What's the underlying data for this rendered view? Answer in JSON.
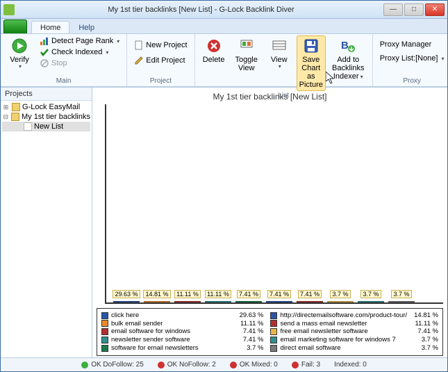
{
  "window": {
    "title": "My 1st tier backlinks [New List] - G-Lock Backlink Diver"
  },
  "tabs": {
    "home": "Home",
    "help": "Help"
  },
  "ribbon": {
    "main": {
      "label": "Main",
      "verify": "Verify",
      "detect_page_rank": "Detect Page Rank",
      "check_indexed": "Check Indexed",
      "stop": "Stop"
    },
    "project": {
      "label": "Project",
      "new_project": "New Project",
      "edit_project": "Edit Project"
    },
    "list": {
      "label": "List",
      "delete": "Delete",
      "toggle_view": "Toggle View",
      "view": "View",
      "save_chart_l1": "Save Chart",
      "save_chart_l2": "as Picture",
      "add_backlinks_l1": "Add to Backlinks",
      "add_backlinks_l2": "Indexer"
    },
    "proxy": {
      "label": "Proxy",
      "proxy_manager": "Proxy Manager",
      "proxy_list": "Proxy List:[None]"
    }
  },
  "sidebar": {
    "title": "Projects",
    "items": [
      {
        "label": "G-Lock EasyMail",
        "expanded": false
      },
      {
        "label": "My 1st tier backlinks",
        "expanded": true,
        "children": [
          {
            "label": "New List",
            "selected": true
          }
        ]
      }
    ]
  },
  "chart_title": "My 1st tier backlinks [New List]",
  "chart_data": {
    "type": "bar",
    "title": "My 1st tier backlinks [New List]",
    "xlabel": "",
    "ylabel": "",
    "ylim": [
      0,
      30
    ],
    "series": [
      {
        "name": "click here",
        "value": 29.63,
        "color": "#2a56a8"
      },
      {
        "name": "bulk email sender",
        "value": 14.81,
        "color": "#e98b2a"
      },
      {
        "name": "email software for windows",
        "value": 11.11,
        "color": "#b23030"
      },
      {
        "name": "newsletter sender software",
        "value": 11.11,
        "color": "#2f8f8f"
      },
      {
        "name": "software for email newsletters",
        "value": 7.41,
        "color": "#1a7a4a"
      },
      {
        "name": "http://directemailsoftware.com/product-tour/",
        "value": 7.41,
        "color": "#2a56a8"
      },
      {
        "name": "send a mass email newsletter",
        "value": 7.41,
        "color": "#b23030"
      },
      {
        "name": "free email newsletter software",
        "value": 3.7,
        "color": "#e9b64a"
      },
      {
        "name": "email marketing software for windows 7",
        "value": 3.7,
        "color": "#2f8f8f"
      },
      {
        "name": "direct email software",
        "value": 3.7,
        "color": "#7a7a7a"
      }
    ],
    "legend_left": [
      {
        "label": "click here",
        "pct": "29.63 %",
        "color": "#2a56a8"
      },
      {
        "label": "bulk email sender",
        "pct": "11.11 %",
        "color": "#e98b2a"
      },
      {
        "label": "email software for windows",
        "pct": "7.41 %",
        "color": "#b23030"
      },
      {
        "label": "newsletter sender software",
        "pct": "7.41 %",
        "color": "#2f8f8f"
      },
      {
        "label": "software for email newsletters",
        "pct": "3.7 %",
        "color": "#1a7a4a"
      }
    ],
    "legend_right": [
      {
        "label": "http://directemailsoftware.com/product-tour/",
        "pct": "14.81 %",
        "color": "#2a56a8"
      },
      {
        "label": "send a mass email newsletter",
        "pct": "11.11 %",
        "color": "#b23030"
      },
      {
        "label": "free email newsletter software",
        "pct": "7.41 %",
        "color": "#e9b64a"
      },
      {
        "label": "email marketing software for windows 7",
        "pct": "3.7 %",
        "color": "#2f8f8f"
      },
      {
        "label": "direct email software",
        "pct": "3.7 %",
        "color": "#7a7a7a"
      }
    ]
  },
  "status": {
    "dofollow": "OK DoFollow: 25",
    "nofollow": "OK NoFollow: 2",
    "mixed": "OK Mixed: 0",
    "fail": "Fail: 3",
    "indexed": "Indexed: 0"
  }
}
